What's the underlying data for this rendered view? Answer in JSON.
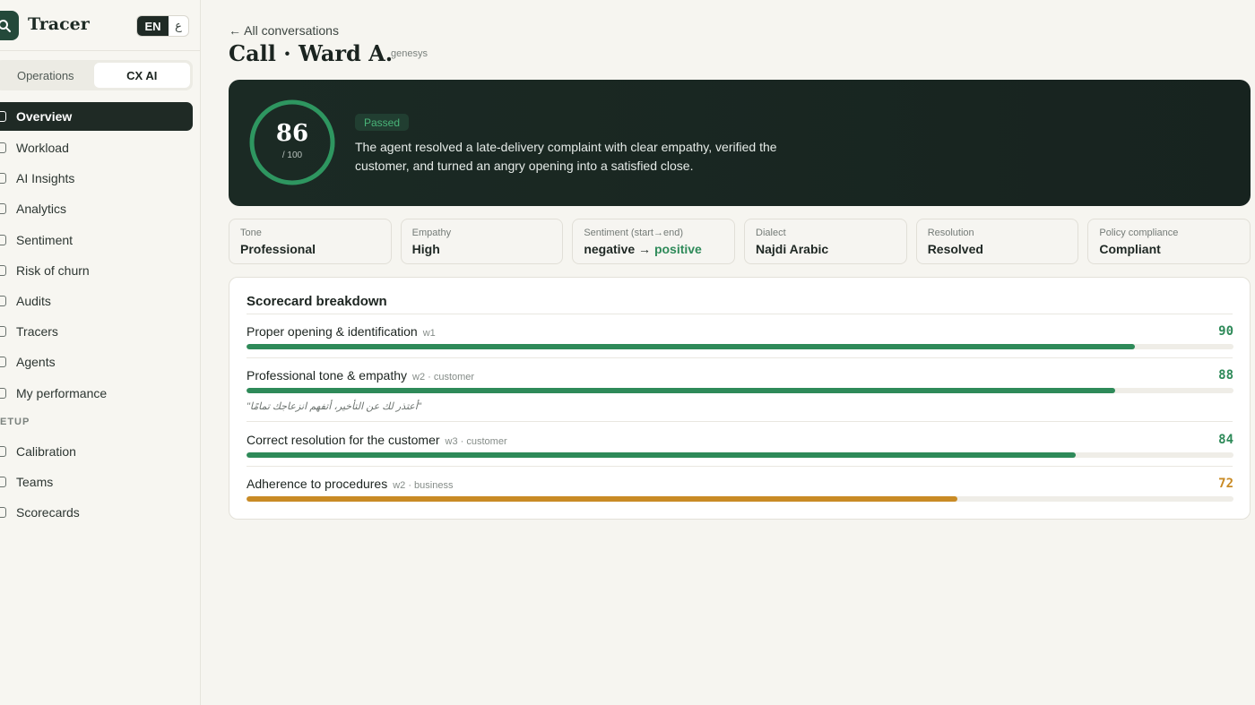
{
  "brand": {
    "name": "Tracer",
    "lang_en": "EN",
    "lang_ar": "ع"
  },
  "segment": {
    "items": [
      "Operations",
      "CX AI"
    ],
    "active": "CX AI"
  },
  "nav": {
    "items": [
      "Overview",
      "Workload",
      "AI Insights",
      "Analytics",
      "Sentiment",
      "Risk of churn",
      "Audits",
      "Tracers",
      "Agents",
      "My performance"
    ],
    "section": "ETUP",
    "setup_items": [
      "Calibration",
      "Teams",
      "Scorecards"
    ],
    "active": "Overview"
  },
  "header": {
    "back": "← All conversations",
    "title": "Call · Ward A.",
    "source": "genesys"
  },
  "hero": {
    "score": "86",
    "score_value": 86,
    "score_max": "/ 100",
    "badge": "Passed",
    "summary": "The agent resolved a late-delivery complaint with clear empathy, verified the customer, and turned an angry opening into a satisfied close."
  },
  "metrics": [
    {
      "label": "Tone",
      "value": "Professional"
    },
    {
      "label": "Empathy",
      "value": "High"
    },
    {
      "label": "Sentiment (start→end)",
      "value_start": "negative",
      "arrow": "→",
      "value_end": "positive"
    },
    {
      "label": "Dialect",
      "value": "Najdi Arabic"
    },
    {
      "label": "Resolution",
      "value": "Resolved"
    },
    {
      "label": "Policy compliance",
      "value": "Compliant"
    }
  ],
  "scorecard": {
    "title": "Scorecard breakdown",
    "rows": [
      {
        "name": "Proper opening & identification",
        "meta": "w1",
        "score": "90",
        "value": 90
      },
      {
        "name": "Professional tone & empathy",
        "meta": "w2 · customer",
        "score": "88",
        "value": 88,
        "quote": "\"أعتذر لك عن التأخير، أتفهم انزعاجك تمامًا\""
      },
      {
        "name": "Correct resolution for the customer",
        "meta": "w3 · customer",
        "score": "84",
        "value": 84
      },
      {
        "name": "Adherence to procedures",
        "meta": "w2 · business",
        "score": "72",
        "value": 72
      }
    ]
  },
  "colors": {
    "good": "#2e8a59",
    "warn": "#c98b25",
    "dark": "#1f2a25"
  }
}
